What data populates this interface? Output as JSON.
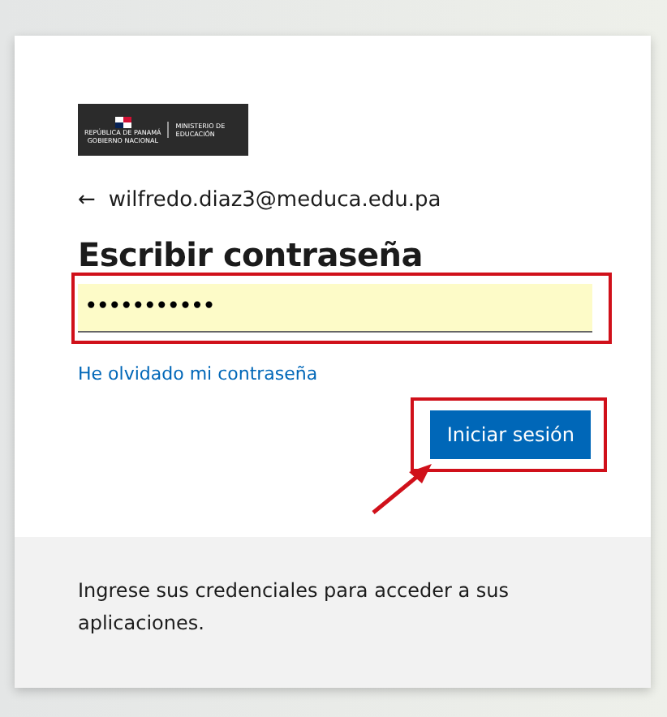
{
  "logo": {
    "country": "REPÚBLICA DE PANAMÁ",
    "government": "GOBIERNO NACIONAL",
    "ministry": "MINISTERIO DE EDUCACIÓN"
  },
  "back": {
    "icon": "←",
    "email": "wilfredo.diaz3@meduca.edu.pa"
  },
  "title": "Escribir contraseña",
  "password": {
    "value": "•••••••••••",
    "highlighted": true
  },
  "forgot_link": "He olvidado mi contraseña",
  "submit": {
    "label": "Iniciar sesión",
    "highlighted": true,
    "arrow": true
  },
  "footer": "Ingrese sus credenciales para acceder a sus aplicaciones."
}
